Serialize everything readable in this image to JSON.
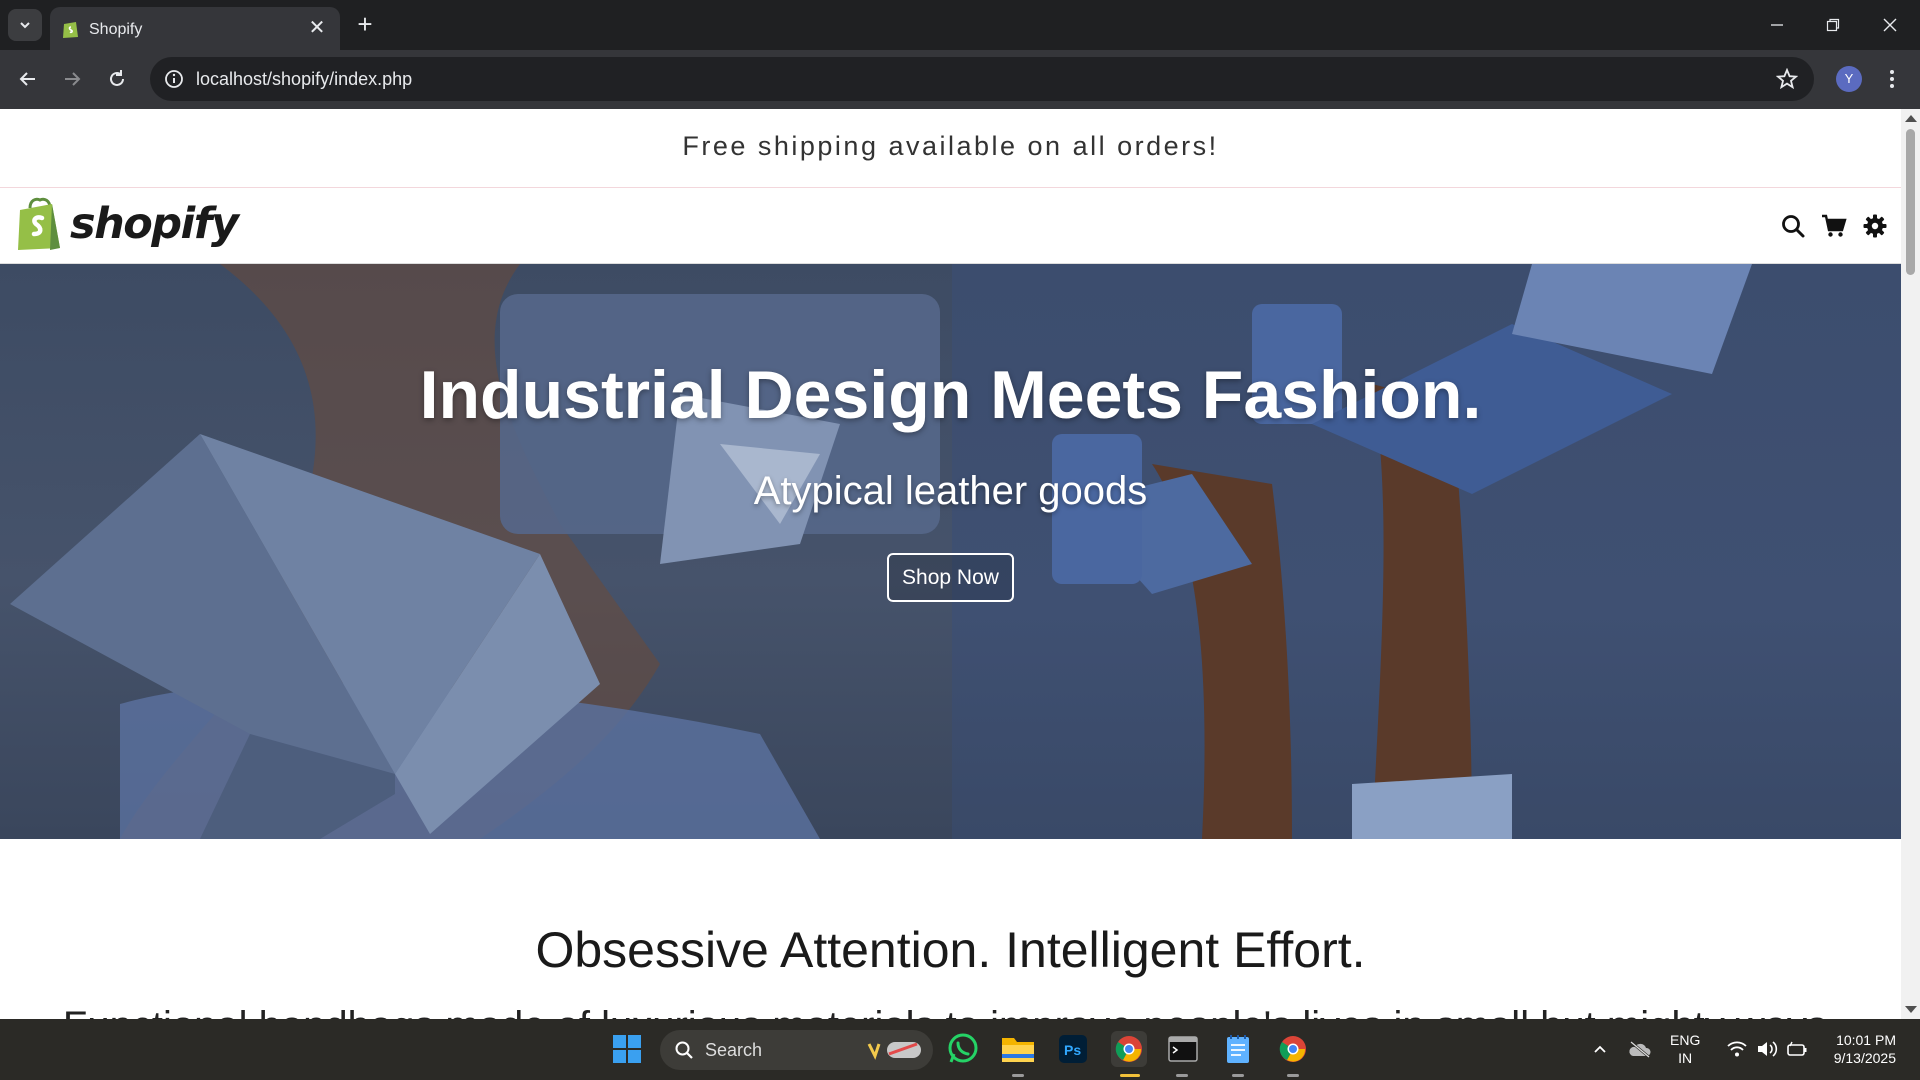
{
  "browser": {
    "tab_title": "Shopify",
    "tab_close": "✕",
    "new_tab": "+",
    "url": "localhost/shopify/index.php",
    "profile_initial": "Y"
  },
  "page": {
    "announcement": "Free shipping available on all orders!",
    "logo_text": "shopify",
    "header_icons": [
      "search-icon",
      "cart-icon",
      "gear-icon"
    ],
    "hero": {
      "title": "Industrial Design Meets Fashion.",
      "subtitle": "Atypical leather goods",
      "button": "Shop Now"
    },
    "section_title": "Obsessive Attention. Intelligent Effort.",
    "section_text_partial": "Functional handbags made of luxurious materials to improve people's lives in small but mighty ways."
  },
  "taskbar": {
    "search_placeholder": "Search",
    "lang_line1": "ENG",
    "lang_line2": "IN",
    "time": "10:01 PM",
    "date": "9/13/2025"
  },
  "colors": {
    "brand_green": "#95bf47",
    "chrome_dark": "#202124",
    "hero_blue": "#3f5072"
  }
}
